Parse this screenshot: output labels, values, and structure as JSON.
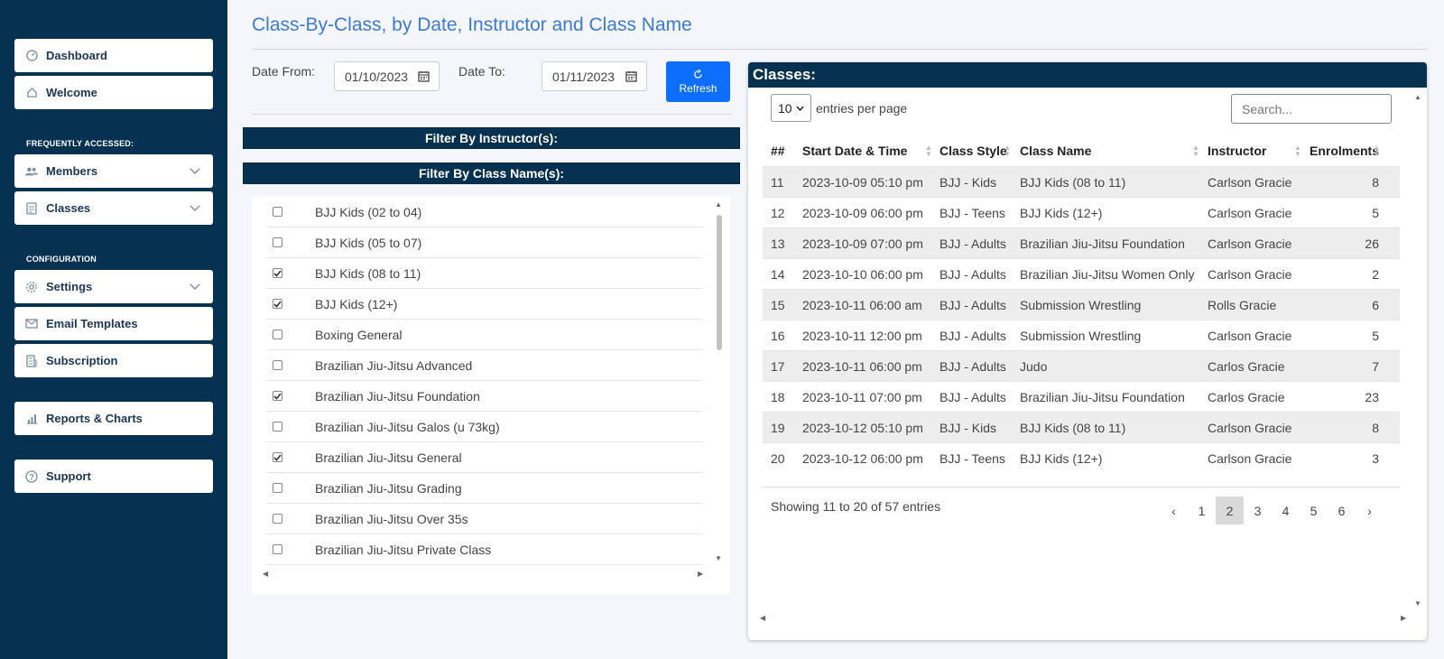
{
  "sidebar": {
    "dashboard": "Dashboard",
    "welcome": "Welcome",
    "frequently_accessed": "FREQUENTLY ACCESSED:",
    "members": "Members",
    "classes": "Classes",
    "configuration": "CONFIGURATION",
    "settings": "Settings",
    "email_templates": "Email Templates",
    "subscription": "Subscription",
    "reports": "Reports & Charts",
    "support": "Support"
  },
  "page": {
    "title": "Class-By-Class, by Date, Instructor and Class Name"
  },
  "form": {
    "date_from_label": "Date From:",
    "date_from_value": "01/10/2023",
    "date_to_label": "Date To:",
    "date_to_value": "01/11/2023",
    "refresh_label": "Refresh",
    "filter_instructor_label": "Filter By Instructor(s):",
    "filter_classname_label": "Filter By Class Name(s):"
  },
  "class_list": [
    {
      "name": "BJJ Kids (02 to 04)",
      "checked": false
    },
    {
      "name": "BJJ Kids (05 to 07)",
      "checked": false
    },
    {
      "name": "BJJ Kids (08 to 11)",
      "checked": true
    },
    {
      "name": "BJJ Kids (12+)",
      "checked": true
    },
    {
      "name": "Boxing General",
      "checked": false
    },
    {
      "name": "Brazilian Jiu-Jitsu Advanced",
      "checked": false
    },
    {
      "name": "Brazilian Jiu-Jitsu Foundation",
      "checked": true
    },
    {
      "name": "Brazilian Jiu-Jitsu Galos (u 73kg)",
      "checked": false
    },
    {
      "name": "Brazilian Jiu-Jitsu General",
      "checked": true
    },
    {
      "name": "Brazilian Jiu-Jitsu Grading",
      "checked": false
    },
    {
      "name": "Brazilian Jiu-Jitsu Over 35s",
      "checked": false
    },
    {
      "name": "Brazilian Jiu-Jitsu Private Class",
      "checked": false
    }
  ],
  "classes_panel": {
    "title": "Classes:",
    "entries_value": "10",
    "entries_label": "entries per page",
    "search_placeholder": "Search...",
    "columns": [
      "##",
      "Start Date & Time",
      "Class Style",
      "Class Name",
      "Instructor",
      "Enrolments"
    ],
    "rows": [
      [
        "11",
        "2023-10-09 05:10 pm",
        "BJJ - Kids",
        "BJJ Kids (08 to 11)",
        "Carlson Gracie",
        "8"
      ],
      [
        "12",
        "2023-10-09 06:00 pm",
        "BJJ - Teens",
        "BJJ Kids (12+)",
        "Carlson Gracie",
        "5"
      ],
      [
        "13",
        "2023-10-09 07:00 pm",
        "BJJ - Adults",
        "Brazilian Jiu-Jitsu Foundation",
        "Carlson Gracie",
        "26"
      ],
      [
        "14",
        "2023-10-10 06:00 pm",
        "BJJ - Adults",
        "Brazilian Jiu-Jitsu Women Only",
        "Carlson Gracie",
        "2"
      ],
      [
        "15",
        "2023-10-11 06:00 am",
        "BJJ - Adults",
        "Submission Wrestling",
        "Rolls Gracie",
        "6"
      ],
      [
        "16",
        "2023-10-11 12:00 pm",
        "BJJ - Adults",
        "Submission Wrestling",
        "Carlson Gracie",
        "5"
      ],
      [
        "17",
        "2023-10-11 06:00 pm",
        "BJJ - Adults",
        "Judo",
        "Carlos Gracie",
        "7"
      ],
      [
        "18",
        "2023-10-11 07:00 pm",
        "BJJ - Adults",
        "Brazilian Jiu-Jitsu Foundation",
        "Carlos Gracie",
        "23"
      ],
      [
        "19",
        "2023-10-12 05:10 pm",
        "BJJ - Kids",
        "BJJ Kids (08 to 11)",
        "Carlson Gracie",
        "8"
      ],
      [
        "20",
        "2023-10-12 06:00 pm",
        "BJJ - Teens",
        "BJJ Kids (12+)",
        "Carlson Gracie",
        "3"
      ]
    ],
    "showing": "Showing 11 to 20 of 57 entries",
    "pagination": {
      "prev": "‹",
      "pages": [
        "1",
        "2",
        "3",
        "4",
        "5",
        "6"
      ],
      "active": "2",
      "next": "›"
    }
  },
  "colors": {
    "sidebar_bg": "#063150",
    "title": "#3a7bd5",
    "primary_button": "#0d6efd"
  }
}
